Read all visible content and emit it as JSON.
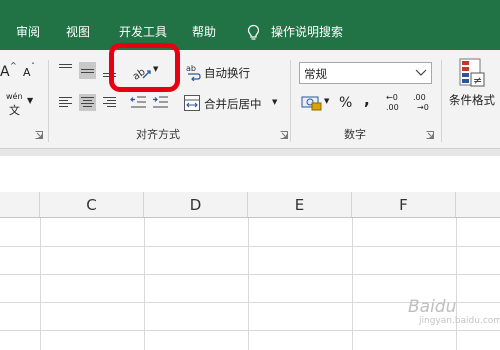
{
  "tabs": [
    "审阅",
    "视图",
    "开发工具",
    "帮助",
    "操作说明搜索"
  ],
  "ribbon": {
    "font_group": {
      "increase_font": "A",
      "decrease_font": "A",
      "phonetic_top": "wén",
      "phonetic_bottom": "文"
    },
    "alignment": {
      "orientation_icon": "ab",
      "wrap_icon": "ab",
      "wrap_text": "自动换行",
      "merge_center": "合并后居中",
      "group_label": "对齐方式"
    },
    "number": {
      "format_value": "常规",
      "percent": "%",
      "comma": ",",
      "increase_decimal_top": "←0",
      "increase_decimal_bottom": ".00",
      "decrease_decimal_top": ".00",
      "decrease_decimal_bottom": "→0",
      "group_label": "数字"
    },
    "styles": {
      "conditional_format": "条件格式"
    }
  },
  "columns": [
    "C",
    "D",
    "E",
    "F"
  ],
  "watermark": {
    "brand": "Baidu",
    "sub": "jingyan.baidu.com"
  },
  "colors": {
    "tab_bar": "#217346",
    "highlight": "#e60012"
  }
}
